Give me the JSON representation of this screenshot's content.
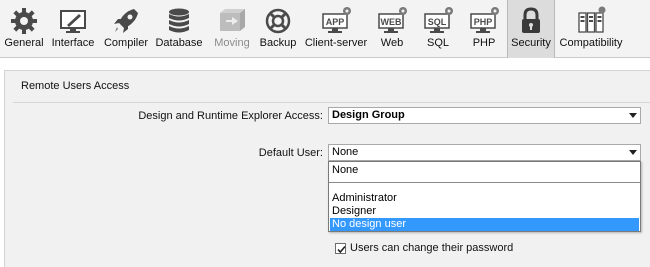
{
  "toolbar": {
    "items": [
      {
        "label": "General",
        "icon": "gear-icon"
      },
      {
        "label": "Interface",
        "icon": "interface-icon"
      },
      {
        "label": "Compiler",
        "icon": "rocket-icon"
      },
      {
        "label": "Database",
        "icon": "database-icon"
      },
      {
        "label": "Moving",
        "icon": "moving-icon"
      },
      {
        "label": "Backup",
        "icon": "lifebuoy-icon"
      },
      {
        "label": "Client-server",
        "icon": "app-icon",
        "badge": "APP"
      },
      {
        "label": "Web",
        "icon": "web-icon",
        "badge": "WEB"
      },
      {
        "label": "SQL",
        "icon": "sql-icon",
        "badge": "SQL"
      },
      {
        "label": "PHP",
        "icon": "php-icon",
        "badge": "PHP"
      },
      {
        "label": "Security",
        "icon": "lock-icon"
      },
      {
        "label": "Compatibility",
        "icon": "compatibility-icon"
      }
    ],
    "active": "Security",
    "disabled": "Moving"
  },
  "panel": {
    "group_title": "Remote Users Access",
    "explorer_access": {
      "label": "Design and Runtime Explorer Access:",
      "value": "Design Group"
    },
    "default_user": {
      "label": "Default User:",
      "value": "None",
      "options": [
        "None",
        "Administrator",
        "Designer",
        "No design user"
      ],
      "highlighted": "No design user"
    },
    "change_password": {
      "label": "Users can change their password",
      "checked": true
    }
  },
  "colors": {
    "toolbar_bg": "#f3f3f3",
    "active_tab_bg": "#dcdcdc",
    "panel_bg": "#f1f1f1",
    "selection": "#3399ff"
  }
}
